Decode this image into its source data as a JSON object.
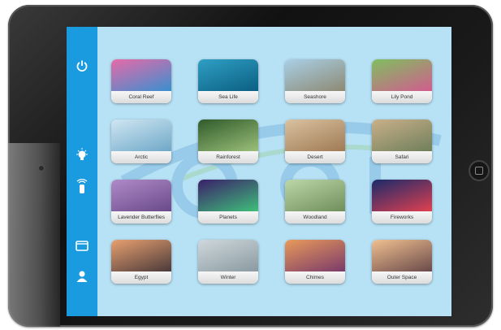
{
  "sidebar": {
    "icons": [
      "power-icon",
      "lightbulb-icon",
      "remote-icon",
      "display-icon",
      "user-icon"
    ]
  },
  "scenes": [
    {
      "label": "Coral Reef",
      "colors": [
        "#e76aa8",
        "#3a8fd0"
      ]
    },
    {
      "label": "Sea Life",
      "colors": [
        "#2f9fc4",
        "#0b5f82"
      ]
    },
    {
      "label": "Seashore",
      "colors": [
        "#a9cfe6",
        "#8d8a73"
      ]
    },
    {
      "label": "Lily Pond",
      "colors": [
        "#7fbf5f",
        "#d25c8f"
      ]
    },
    {
      "label": "Arctic",
      "colors": [
        "#cfe6f2",
        "#6fa8c8"
      ]
    },
    {
      "label": "Rainforest",
      "colors": [
        "#2f5a2a",
        "#9bbf7a"
      ]
    },
    {
      "label": "Desert",
      "colors": [
        "#d9c2a0",
        "#a07a55"
      ]
    },
    {
      "label": "Safari",
      "colors": [
        "#c9b08a",
        "#6f7f5a"
      ]
    },
    {
      "label": "Lavender Butterflies",
      "colors": [
        "#b08ac8",
        "#6a4a8a"
      ]
    },
    {
      "label": "Planets",
      "colors": [
        "#3a1f6a",
        "#3fbf7a"
      ]
    },
    {
      "label": "Woodland",
      "colors": [
        "#bcd6a8",
        "#6f8f5a"
      ]
    },
    {
      "label": "Fireworks",
      "colors": [
        "#1a2a6a",
        "#e04050"
      ]
    },
    {
      "label": "Egypt",
      "colors": [
        "#e8a070",
        "#4a3a3a"
      ]
    },
    {
      "label": "Winter",
      "colors": [
        "#cfd8dc",
        "#8a9aa0"
      ]
    },
    {
      "label": "Chimes",
      "colors": [
        "#e89a5a",
        "#7a3a6a"
      ]
    },
    {
      "label": "Outer Space",
      "colors": [
        "#f0c090",
        "#6a4a4a"
      ]
    }
  ],
  "colors": {
    "sidebar": "#1a9be0",
    "screen": "#b7e1f4"
  }
}
